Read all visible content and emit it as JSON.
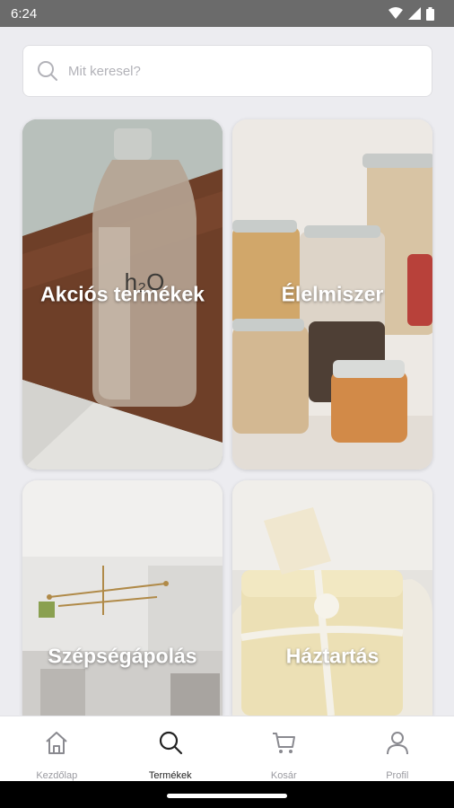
{
  "status_bar": {
    "time": "6:24"
  },
  "search": {
    "placeholder": "Mit keresel?"
  },
  "categories": [
    {
      "label": "Akciós termékek"
    },
    {
      "label": "Élelmiszer"
    },
    {
      "label": "Szépségápolás"
    },
    {
      "label": "Háztartás"
    }
  ],
  "bottom_nav": {
    "items": [
      {
        "label": "Kezdőlap",
        "icon": "home-icon"
      },
      {
        "label": "Termékek",
        "icon": "search-icon",
        "active": true
      },
      {
        "label": "Kosár",
        "icon": "cart-icon"
      },
      {
        "label": "Profil",
        "icon": "profile-icon"
      }
    ]
  },
  "colors": {
    "background": "#ececf0",
    "status_bar": "#6b6b6b",
    "nav_active": "#222222",
    "nav_inactive": "#9a9aa0"
  }
}
